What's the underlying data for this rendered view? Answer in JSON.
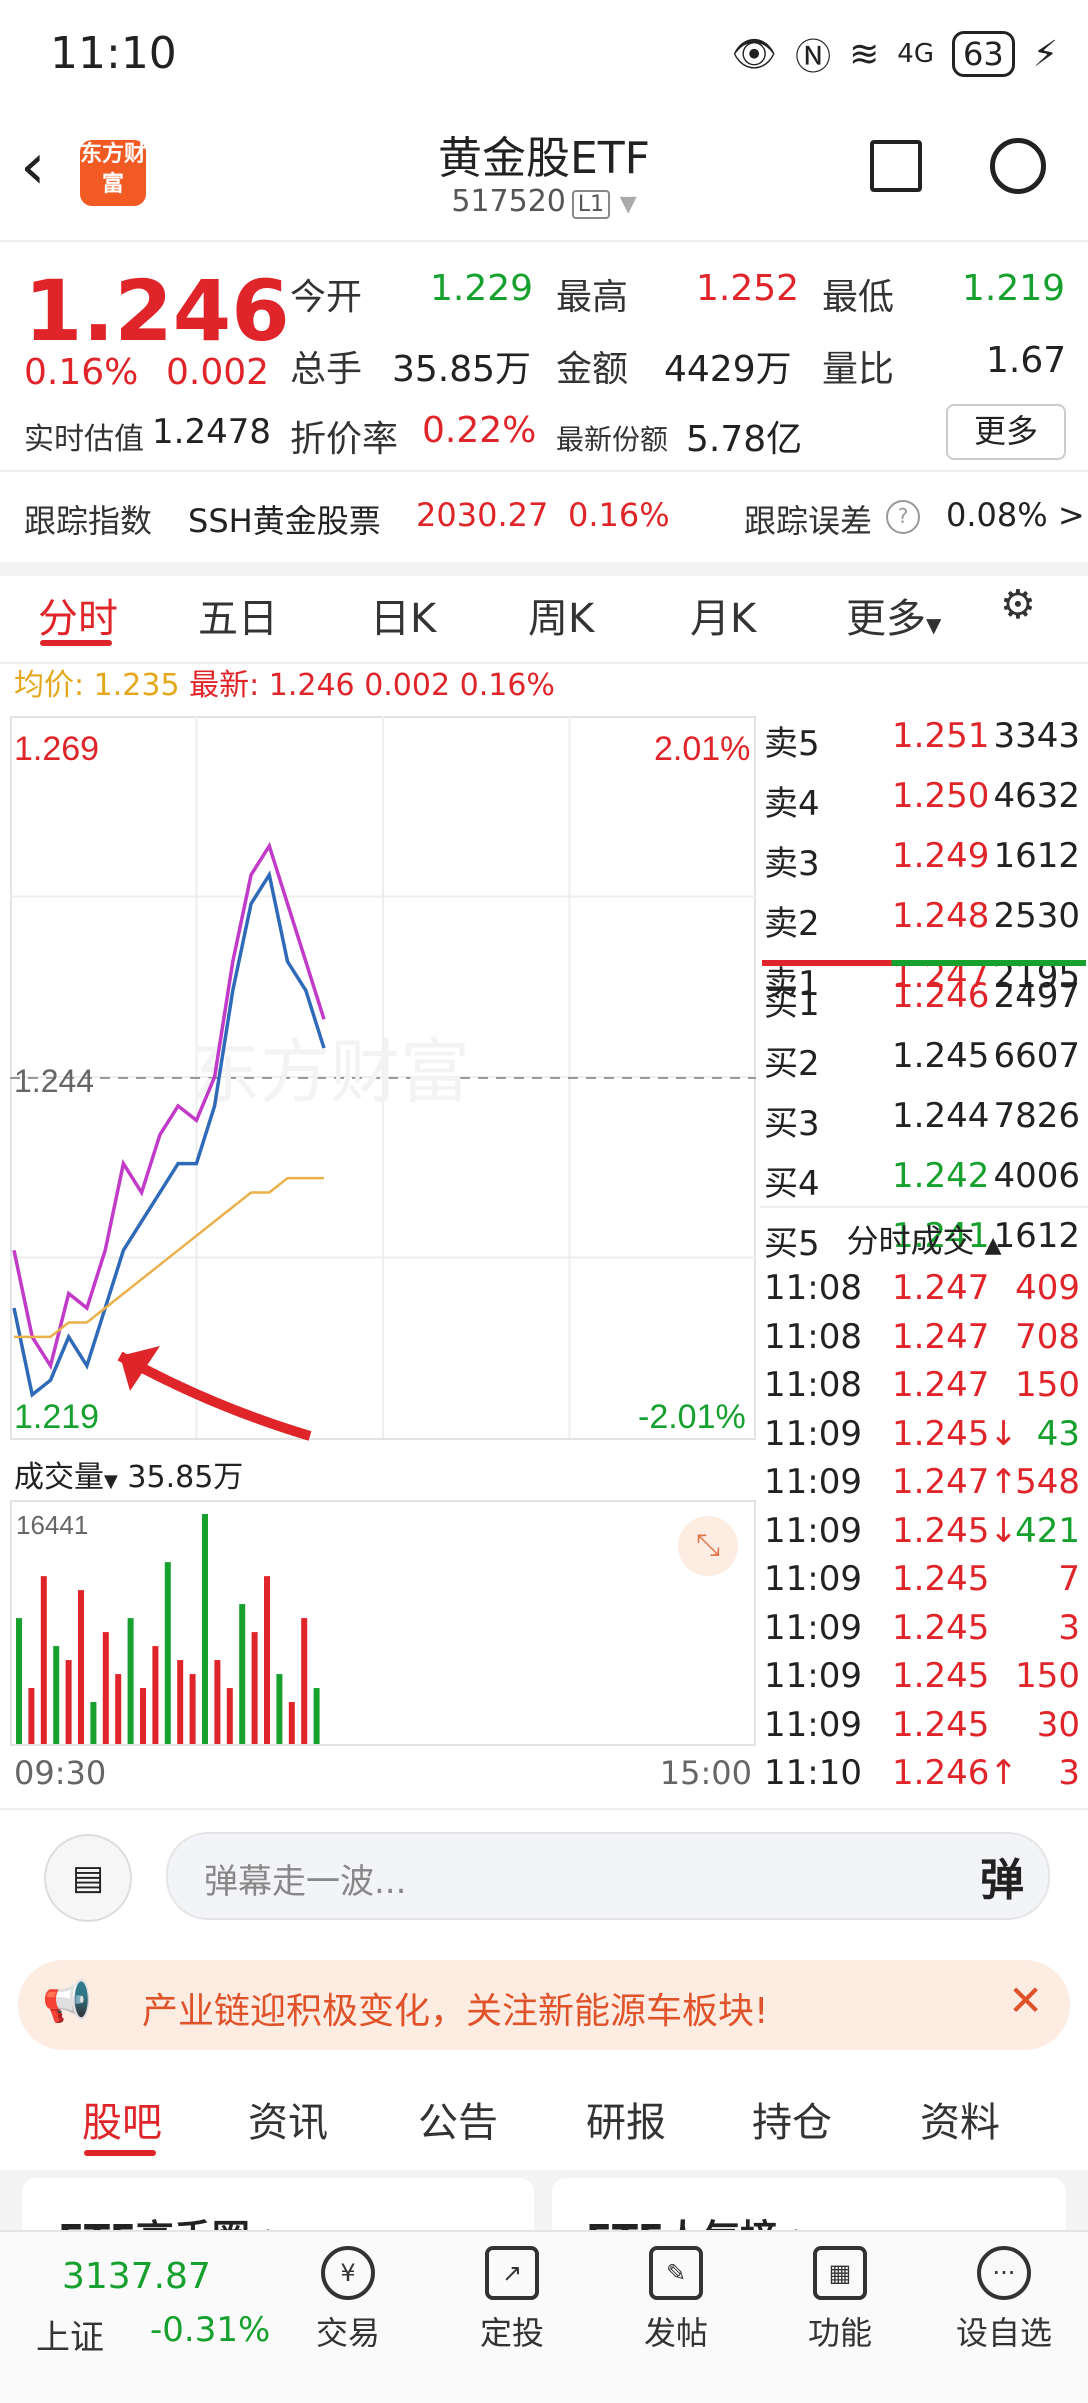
{
  "status": {
    "time": "11:10",
    "signal": "4G",
    "battery": "63"
  },
  "header": {
    "logo_text": "东方财富",
    "title": "黄金股ETF",
    "code": "517520",
    "level": "L1"
  },
  "quote": {
    "price": "1.246",
    "change_pct": "0.16%",
    "change": "0.002",
    "est_label": "实时估值",
    "est_value": "1.2478",
    "open_label": "今开",
    "open": "1.229",
    "high_label": "最高",
    "high": "1.252",
    "low_label": "最低",
    "low": "1.219",
    "vol_label": "总手",
    "vol": "35.85万",
    "amt_label": "金额",
    "amt": "4429万",
    "ratio_label": "量比",
    "ratio": "1.67",
    "discount_label": "折价率",
    "discount": "0.22%",
    "shares_label": "最新份额",
    "shares": "5.78亿",
    "more": "更多"
  },
  "tracking": {
    "label": "跟踪指数",
    "index_name": "SSH黄金股票",
    "index_value": "2030.27",
    "index_pct": "0.16%",
    "error_label": "跟踪误差",
    "error_value": "0.08% >"
  },
  "tabs": [
    "分时",
    "五日",
    "日K",
    "周K",
    "月K",
    "更多"
  ],
  "avg": {
    "avg_label": "均价:",
    "avg_value": "1.235",
    "latest_label": "最新:",
    "latest_price": "1.246",
    "latest_change": "0.002",
    "latest_pct": "0.16%"
  },
  "chart": {
    "top_price": "1.269",
    "top_pct": "2.01%",
    "mid_price": "1.244",
    "bottom_price": "1.219",
    "bottom_pct": "-2.01%",
    "watermark": "东方财富",
    "volume_label": "成交量",
    "volume_total": "35.85万",
    "volume_max": "16441",
    "time_start": "09:30",
    "time_end": "15:00"
  },
  "chart_data": {
    "type": "line",
    "ylim": [
      1.219,
      1.269
    ],
    "series": [
      {
        "values": [
          1.232,
          1.226,
          1.224,
          1.229,
          1.228,
          1.232,
          1.238,
          1.236,
          1.24,
          1.242,
          1.241,
          1.244,
          1.252,
          1.258,
          1.26,
          1.256,
          1.252,
          1.248
        ]
      },
      {
        "values": [
          1.228,
          1.222,
          1.223,
          1.226,
          1.224,
          1.228,
          1.232,
          1.234,
          1.236,
          1.238,
          1.238,
          1.242,
          1.25,
          1.256,
          1.258,
          1.252,
          1.25,
          1.246
        ]
      },
      {
        "values": [
          1.226,
          1.226,
          1.226,
          1.227,
          1.227,
          1.228,
          1.229,
          1.23,
          1.231,
          1.232,
          1.233,
          1.234,
          1.235,
          1.236,
          1.236,
          1.237,
          1.237,
          1.237
        ]
      }
    ],
    "volume": [
      9000,
      4000,
      12000,
      7000,
      6000,
      11000,
      3000,
      8000,
      5000,
      9000,
      4000,
      7000,
      13000,
      6000,
      5000,
      16441,
      6000,
      4000,
      10000,
      8000,
      12000,
      5000,
      3000,
      9000,
      4000
    ]
  },
  "orderbook": {
    "asks": [
      {
        "label": "卖5",
        "price": "1.251",
        "vol": "3343"
      },
      {
        "label": "卖4",
        "price": "1.250",
        "vol": "4632"
      },
      {
        "label": "卖3",
        "price": "1.249",
        "vol": "1612"
      },
      {
        "label": "卖2",
        "price": "1.248",
        "vol": "2530"
      },
      {
        "label": "卖1",
        "price": "1.247",
        "vol": "2195"
      }
    ],
    "bids": [
      {
        "label": "买1",
        "price": "1.246",
        "vol": "2497"
      },
      {
        "label": "买2",
        "price": "1.245",
        "vol": "6607"
      },
      {
        "label": "买3",
        "price": "1.244",
        "vol": "7826"
      },
      {
        "label": "买4",
        "price": "1.242",
        "vol": "4006"
      },
      {
        "label": "买5",
        "price": "1.241",
        "vol": "1612"
      }
    ],
    "ticks_title": "分时成交",
    "ticks": [
      {
        "time": "11:08",
        "price": "1.247",
        "vol": "409"
      },
      {
        "time": "11:08",
        "price": "1.247",
        "vol": "708"
      },
      {
        "time": "11:08",
        "price": "1.247",
        "vol": "150"
      },
      {
        "time": "11:09",
        "price": "1.245↓",
        "vol": "43"
      },
      {
        "time": "11:09",
        "price": "1.247↑",
        "vol": "548"
      },
      {
        "time": "11:09",
        "price": "1.245↓",
        "vol": "421"
      },
      {
        "time": "11:09",
        "price": "1.245",
        "vol": "7"
      },
      {
        "time": "11:09",
        "price": "1.245",
        "vol": "3"
      },
      {
        "time": "11:09",
        "price": "1.245",
        "vol": "150"
      },
      {
        "time": "11:09",
        "price": "1.245",
        "vol": "30"
      },
      {
        "time": "11:10",
        "price": "1.246↑",
        "vol": "3"
      }
    ]
  },
  "barrage": {
    "placeholder": "弹幕走一波...",
    "button": "弹"
  },
  "promo": {
    "text": "产业链迎积极变化，关注新能源车板块!"
  },
  "bottom_tabs": [
    "股吧",
    "资讯",
    "公告",
    "研报",
    "持仓",
    "资料"
  ],
  "cards": {
    "left": "ETF高手圈 >",
    "right": "ETF人气榜 >"
  },
  "nav": {
    "index_value": "3137.87",
    "index_name": "上证",
    "index_pct": "-0.31%",
    "items": [
      "交易",
      "定投",
      "发帖",
      "功能",
      "设自选"
    ]
  }
}
